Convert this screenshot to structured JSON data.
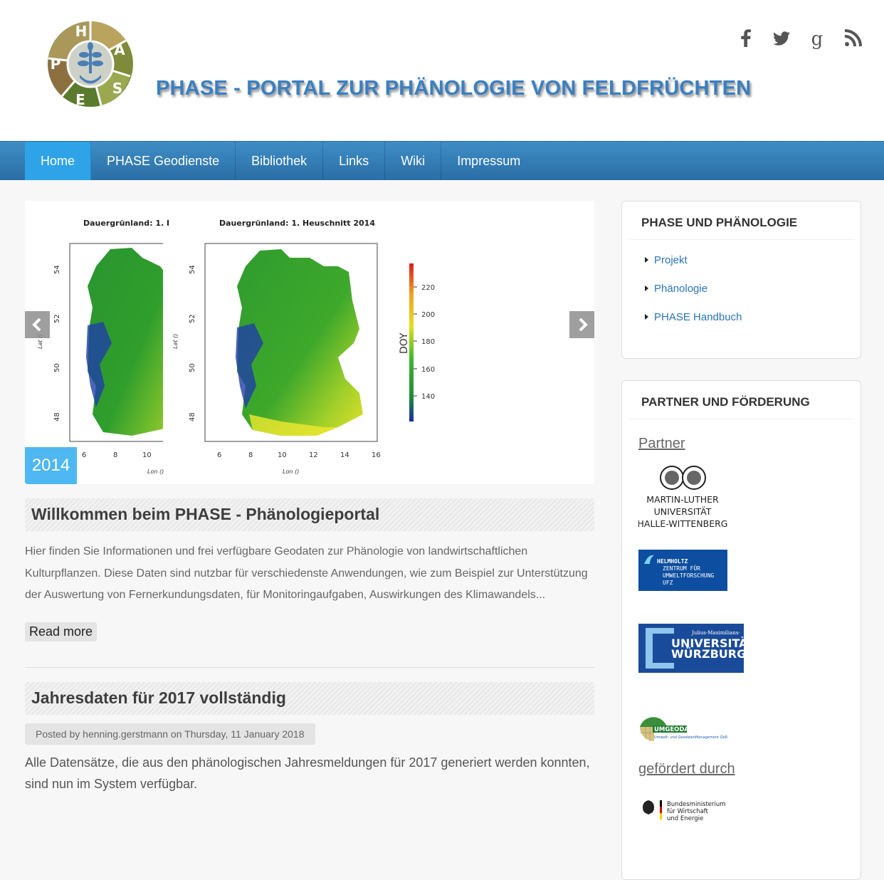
{
  "header": {
    "logo_letters": {
      "top": "H",
      "right": "A",
      "right_low": "S",
      "bottom": "E",
      "left": "P"
    },
    "site_title": "PHASE - PORTAL ZUR PHÄNOLOGIE VON FELDFRÜCHTEN",
    "social": [
      {
        "name": "facebook-icon",
        "glyph": "f"
      },
      {
        "name": "twitter-icon",
        "glyph": "twitter"
      },
      {
        "name": "google-plus-icon",
        "glyph": "g"
      },
      {
        "name": "rss-icon",
        "glyph": "rss"
      }
    ]
  },
  "nav": {
    "items": [
      {
        "label": "Home",
        "active": true
      },
      {
        "label": "PHASE Geodienste"
      },
      {
        "label": "Bibliothek"
      },
      {
        "label": "Links"
      },
      {
        "label": "Wiki"
      },
      {
        "label": "Impressum"
      }
    ]
  },
  "slider": {
    "map_title_left": "Dauergrünland: 1. I",
    "map_title_right": "Dauergrünland: 1. Heuschnitt 2014",
    "y_ticks": [
      "54",
      "52",
      "50",
      "48"
    ],
    "x_ticks_left": [
      "6",
      "8",
      "10"
    ],
    "x_ticks_right": [
      "6",
      "8",
      "10",
      "12",
      "14",
      "16"
    ],
    "y_axis_label": "Lat ()",
    "x_axis_label": "Lon ()",
    "colorbar_label": "DOY",
    "colorbar_ticks": [
      "220",
      "200",
      "180",
      "160",
      "140"
    ],
    "caption": "2014"
  },
  "post1": {
    "title": "Willkommen beim PHASE - Phänologieportal",
    "body": "Hier finden Sie Informationen und frei verfügbare Geodaten zur Phänologie von landwirtschaftlichen Kulturpflanzen. Diese Daten sind nutzbar für verschiedenste Anwendungen, wie zum Beispiel zur Unterstützung der Auswertung von Fernerkundungsdaten, für Monitoringaufgaben, Auswirkungen des Klimawandels...",
    "read_more": "Read more"
  },
  "post2": {
    "title": "Jahresdaten für 2017 vollständig",
    "meta_prefix": "Posted by",
    "author": "henning.gerstmann",
    "meta_on": "on",
    "date": "Thursday, 11 January 2018",
    "body": "Alle Datensätze, die aus den phänologischen Jahresmeldungen für 2017 generiert werden konnten, sind nun im System verfügbar."
  },
  "sidebar": {
    "block1": {
      "title": "PHASE UND PHÄNOLOGIE",
      "links": [
        "Projekt",
        "Phänologie",
        "PHASE Handbuch"
      ]
    },
    "block2": {
      "title": "PARTNER UND FÖRDERUNG",
      "partner_heading": "Partner",
      "mlu": {
        "line1": "MARTIN-LUTHER",
        "line2": "UNIVERSITÄT",
        "line3": "HALLE-WITTENBERG"
      },
      "ufz": {
        "line1": "HELMHOLTZ",
        "line2": "ZENTRUM FÜR",
        "line3": "UMWELTFORSCHUNG",
        "line4": "UFZ"
      },
      "wue": {
        "small": "Julius-Maximilians-",
        "line1": "UNIVERSITÄT",
        "line2": "WÜRZBURG"
      },
      "umgeodat": {
        "name": "UMGEODAT",
        "sub": "Umwelt- und GeodatenManagement GbR"
      },
      "funded_heading": "gefördert durch",
      "bmwi": {
        "line1": "Bundesministerium",
        "line2": "für Wirtschaft",
        "line3": "und Energie"
      }
    }
  },
  "colors": {
    "nav": "#2f78b3",
    "nav_active": "#2ea3e8",
    "link": "#2a74b8",
    "caption": "#4fb7f2",
    "title_blue": "#3a7fc1"
  }
}
